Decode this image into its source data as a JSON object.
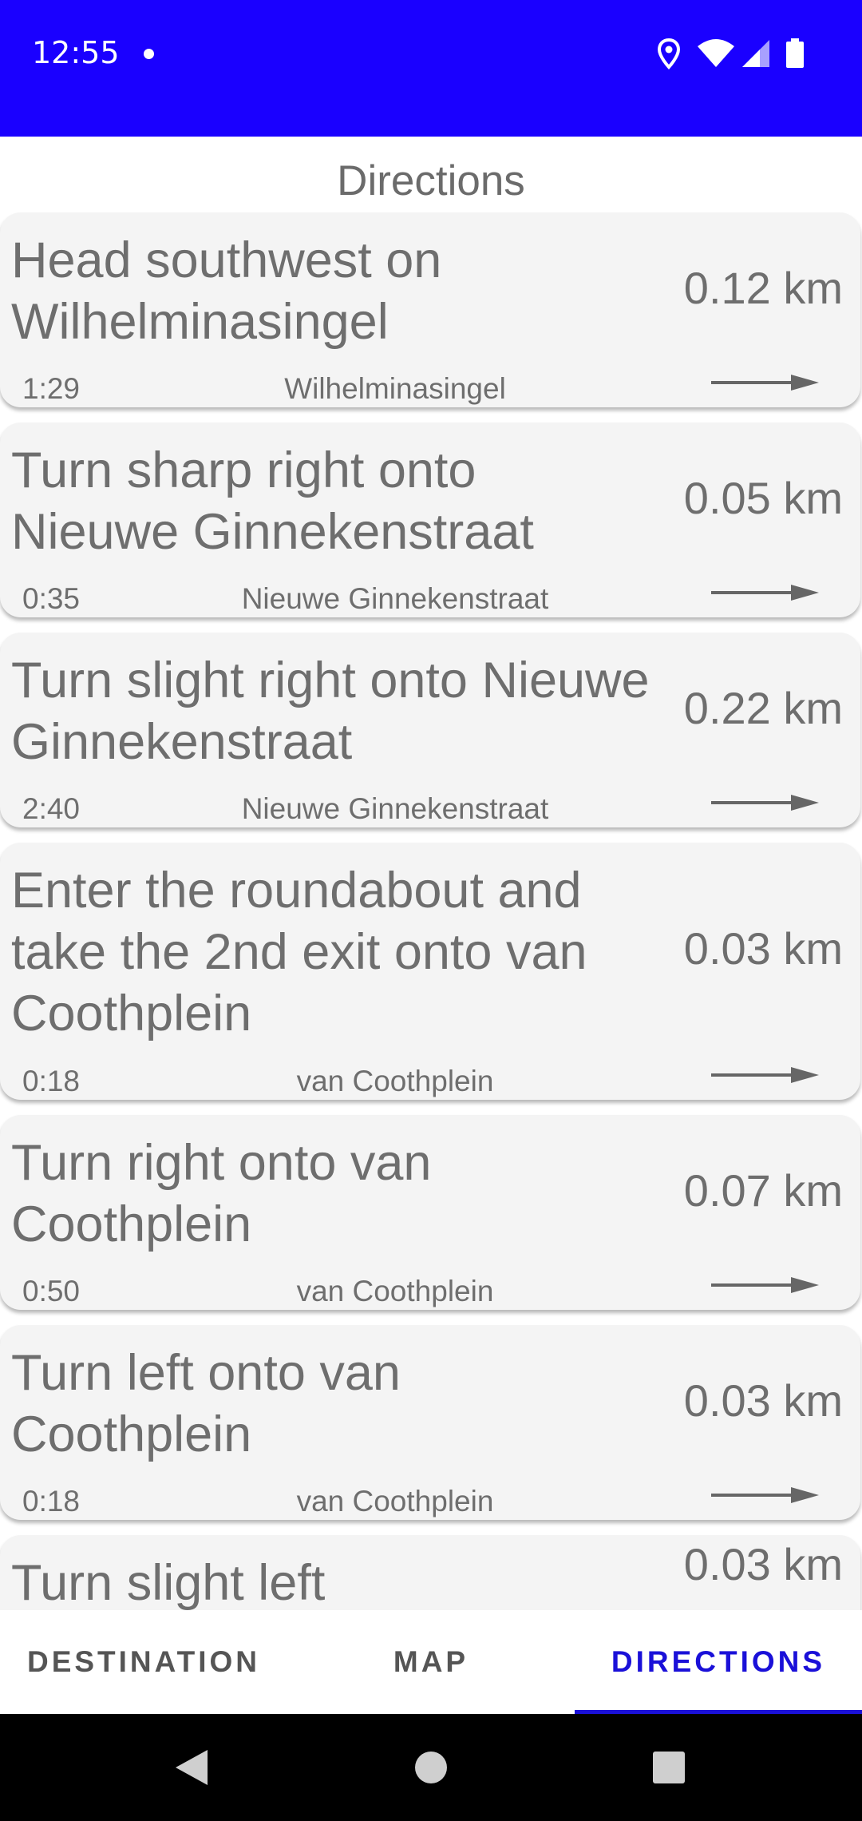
{
  "status_bar": {
    "time": "12:55",
    "background": "#1a00ff",
    "icons": [
      "location-icon",
      "wifi-icon",
      "signal-icon",
      "battery-icon"
    ]
  },
  "title": "Directions",
  "directions": [
    {
      "instruction": "Head southwest on Wilhelminasingel",
      "distance": "0.12 km",
      "time": "1:29",
      "street": "Wilhelminasingel"
    },
    {
      "instruction": "Turn sharp right onto Nieuwe Ginnekenstraat",
      "distance": "0.05 km",
      "time": "0:35",
      "street": "Nieuwe Ginnekenstraat"
    },
    {
      "instruction": "Turn slight right onto Nieuwe Ginnekenstraat",
      "distance": "0.22 km",
      "time": "2:40",
      "street": "Nieuwe Ginnekenstraat"
    },
    {
      "instruction": "Enter the roundabout and take the 2nd exit onto van Coothplein",
      "distance": "0.03 km",
      "time": "0:18",
      "street": "van Coothplein"
    },
    {
      "instruction": "Turn right onto van Coothplein",
      "distance": "0.07 km",
      "time": "0:50",
      "street": "van Coothplein"
    },
    {
      "instruction": "Turn left onto van Coothplein",
      "distance": "0.03 km",
      "time": "0:18",
      "street": "van Coothplein"
    },
    {
      "instruction": "Turn slight left",
      "distance": "0.03 km",
      "time": "",
      "street": ""
    }
  ],
  "tabs": [
    {
      "label": "DESTINATION",
      "active": false
    },
    {
      "label": "MAP",
      "active": false
    },
    {
      "label": "DIRECTIONS",
      "active": true
    }
  ],
  "accent_color": "#1a10d8",
  "nav_bar": {
    "icons": [
      "back-icon",
      "home-icon",
      "recents-icon"
    ]
  }
}
